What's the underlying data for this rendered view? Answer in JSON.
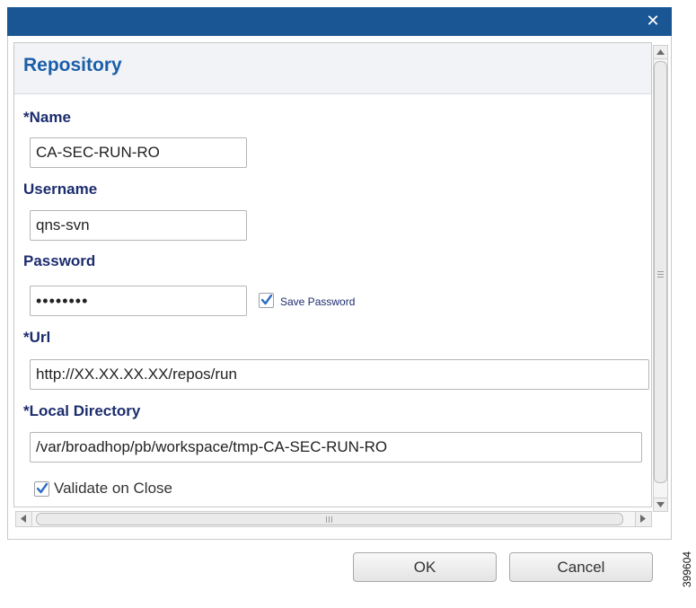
{
  "dialog": {
    "close_glyph": "✕",
    "panel_title": "Repository",
    "fields": {
      "name_label": "*Name",
      "name_value": "CA-SEC-RUN-RO",
      "username_label": "Username",
      "username_value": "qns-svn",
      "password_label": "Password",
      "password_value": "••••••••",
      "save_password_label": "Save Password",
      "save_password_checked": true,
      "url_label": "*Url",
      "url_value": "http://XX.XX.XX.XX/repos/run",
      "local_dir_label": "*Local Directory",
      "local_dir_value": "/var/broadhop/pb/workspace/tmp-CA-SEC-RUN-RO",
      "validate_label": "Validate on Close",
      "validate_checked": true
    },
    "buttons": {
      "ok": "OK",
      "cancel": "Cancel"
    },
    "icons": {
      "close": "close-icon",
      "scroll_up": "chevron-up-icon",
      "scroll_down": "chevron-down-icon",
      "scroll_left": "chevron-left-icon",
      "scroll_right": "chevron-right-icon",
      "checkmark": "checkmark-icon"
    },
    "colors": {
      "titlebar": "#1a5594",
      "title_text": "#1a5ea8",
      "label_text": "#1c2d6e",
      "checkmark": "#2b6cc4"
    }
  },
  "figure_id": "399604"
}
